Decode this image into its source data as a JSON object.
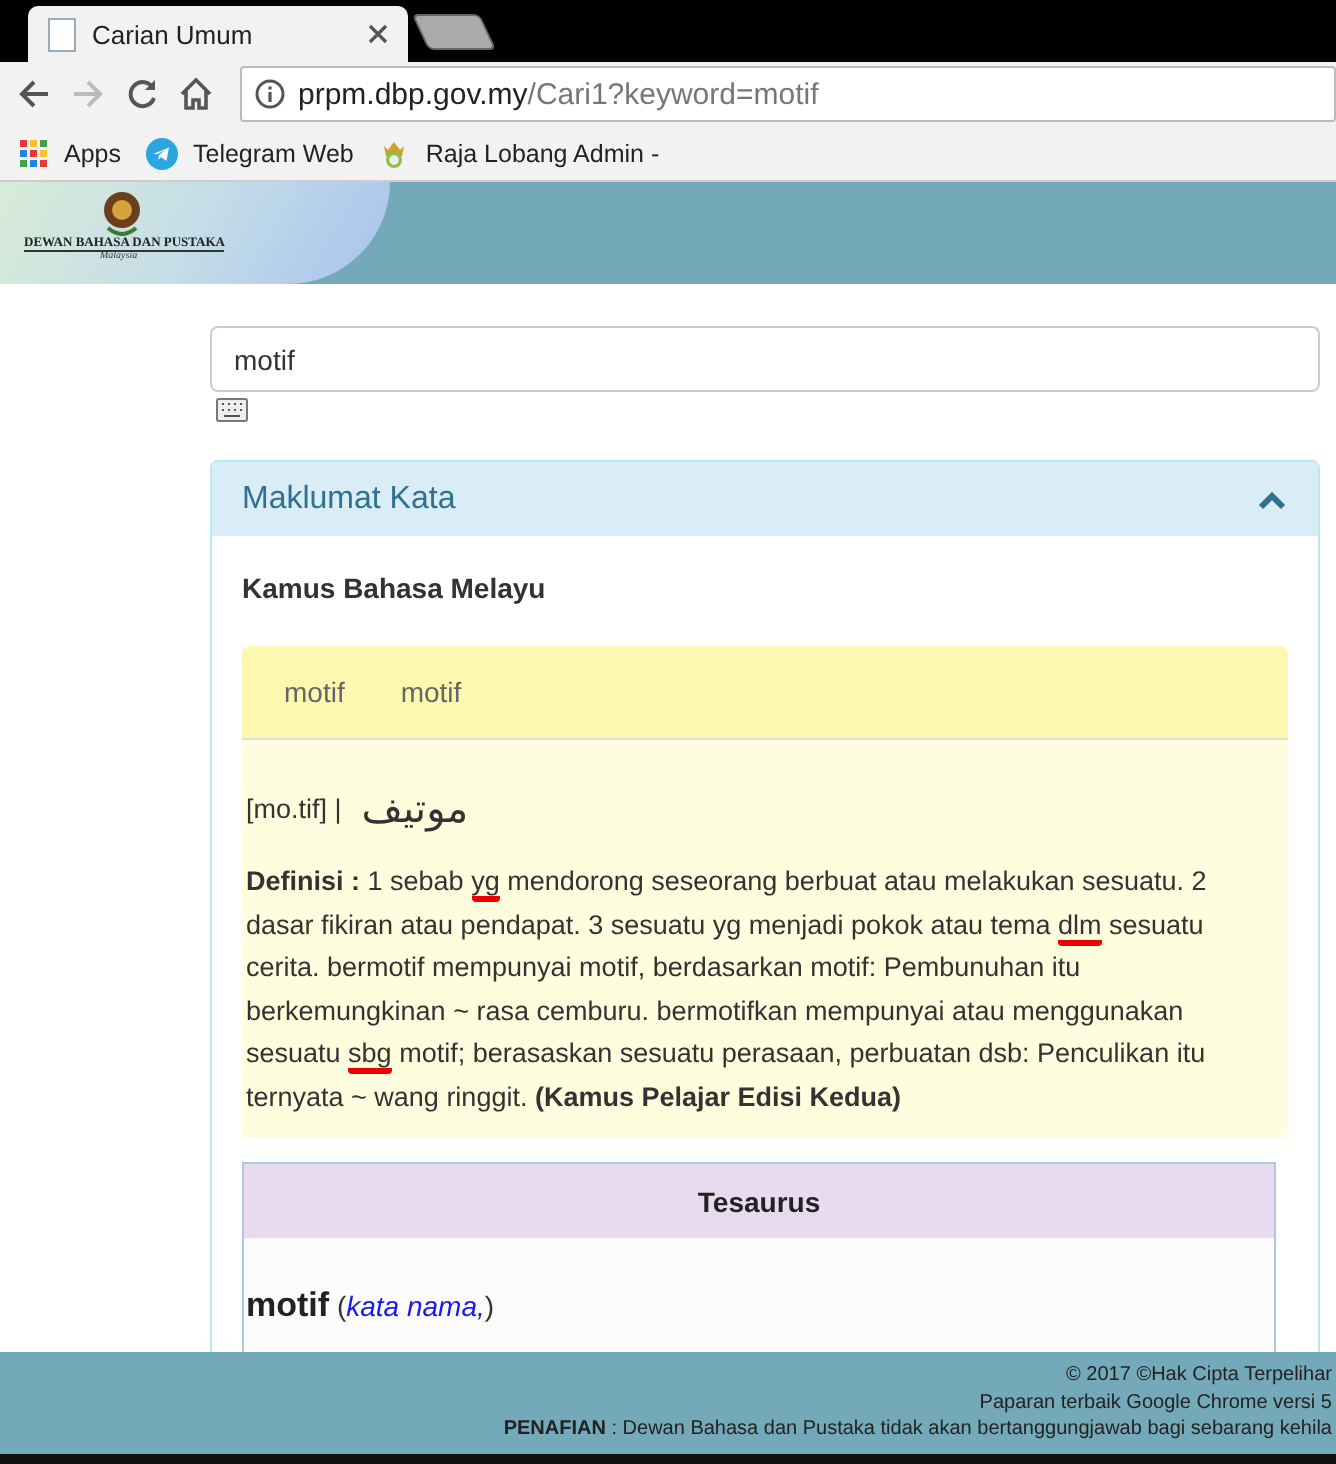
{
  "browser": {
    "tabs": [
      {
        "title": "Carian Umum",
        "selected": true
      },
      {
        "selected": false
      }
    ],
    "url_host": "prpm.dbp.gov.my",
    "url_path": "/Cari1?keyword=motif",
    "bookmarks": [
      {
        "label": "Apps",
        "kind": "apps"
      },
      {
        "label": "Telegram Web",
        "kind": "telegram"
      },
      {
        "label": "Raja Lobang Admin -",
        "kind": "site"
      }
    ]
  },
  "banner": {
    "logo_lines": [
      "DEWAN BAHASA DAN PUSTAKA",
      "Malaysia"
    ]
  },
  "search": {
    "value": "motif"
  },
  "panel": {
    "title": "Maklumat Kata",
    "expanded": true,
    "source": "Kamus Bahasa Melayu",
    "entry": {
      "tabs": [
        "motif",
        "motif"
      ],
      "pronunciation": "[mo.tif] |",
      "jawi": "موتيف",
      "definition": [
        {
          "text": "Definisi :",
          "bold": true,
          "misspelled": false
        },
        {
          "text": " 1 sebab ",
          "bold": false,
          "misspelled": false
        },
        {
          "text": "yg",
          "bold": false,
          "misspelled": true
        },
        {
          "text": " mendorong seseorang berbuat atau melakukan sesuatu. 2 dasar fikiran atau pendapat. 3 sesuatu yg menjadi pokok atau tema ",
          "bold": false,
          "misspelled": false
        },
        {
          "text": "dlm",
          "bold": false,
          "misspelled": true
        },
        {
          "text": " sesuatu cerita. bermotif mempunyai motif, berdasarkan motif: Pembunuhan itu berkemungkinan ~ rasa cemburu. bermotifkan mempunyai atau menggunakan sesuatu ",
          "bold": false,
          "misspelled": false
        },
        {
          "text": "sbg",
          "bold": false,
          "misspelled": true
        },
        {
          "text": " motif; berasaskan sesuatu perasaan, perbuatan dsb: Penculikan itu ternyata ~ wang ringgit. ",
          "bold": false,
          "misspelled": false
        },
        {
          "text": "(Kamus Pelajar Edisi Kedua)",
          "bold": true,
          "misspelled": false
        }
      ]
    },
    "thesaurus": {
      "title": "Tesaurus",
      "word": "motif",
      "open_paren": "(",
      "word_class": "kata nama,",
      "close_paren": ")"
    }
  },
  "footer": {
    "lines": [
      {
        "text": "© 2017 ©Hak Cipta Terpelihar"
      },
      {
        "text": "Paparan terbaik Google Chrome versi 5"
      },
      {
        "label": "PENAFIAN",
        "text": " : Dewan Bahasa dan Pustaka tidak akan bertanggungjawab bagi sebarang kehila"
      }
    ]
  }
}
